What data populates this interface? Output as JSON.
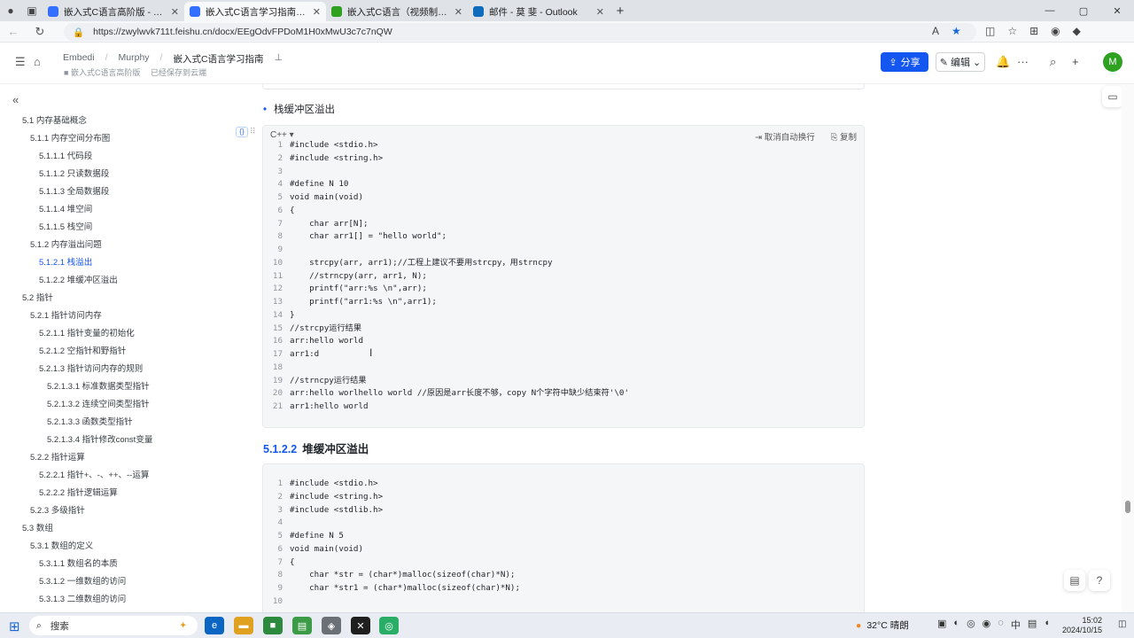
{
  "browser": {
    "tabs": [
      {
        "title": "嵌入式C语言高阶版 - 飞书云文档",
        "favicon_color": "#3370ff",
        "active": false
      },
      {
        "title": "嵌入式C语言学习指南 - 飞书云文档",
        "favicon_color": "#3370ff",
        "active": true
      },
      {
        "title": "嵌入式C语言（视频制作） - 飞书",
        "favicon_color": "#2ea121",
        "active": false
      },
      {
        "title": "邮件 - 莫 斐 - Outlook",
        "favicon_color": "#0f6cbd",
        "active": false
      }
    ],
    "url": "https://zwylwvk711t.feishu.cn/docx/EEgOdvFPDoM1H0xMwU3c7c7nQW"
  },
  "doc_header": {
    "breadcrumb": [
      "Embedi",
      "Murphy",
      "嵌入式C语言学习指南"
    ],
    "sub_left": "嵌入式C语言高阶版",
    "sub_right": "已经保存到云端",
    "share_label": "分享",
    "edit_label": "编辑",
    "avatar_letter": "M",
    "brand_color": "#1456f0"
  },
  "toc": [
    {
      "text": "5.1 内存基础概念",
      "level": 1
    },
    {
      "text": "5.1.1 内存空间分布图",
      "level": 2
    },
    {
      "text": "5.1.1.1 代码段",
      "level": 3
    },
    {
      "text": "5.1.1.2 只读数据段",
      "level": 3
    },
    {
      "text": "5.1.1.3 全局数据段",
      "level": 3
    },
    {
      "text": "5.1.1.4 堆空间",
      "level": 3
    },
    {
      "text": "5.1.1.5 栈空间",
      "level": 3
    },
    {
      "text": "5.1.2 内存溢出问题",
      "level": 2
    },
    {
      "text": "5.1.2.1 栈溢出",
      "level": 3,
      "active": true
    },
    {
      "text": "5.1.2.2 堆缓冲区溢出",
      "level": 3
    },
    {
      "text": "5.2 指针",
      "level": 1
    },
    {
      "text": "5.2.1 指针访问内存",
      "level": 2
    },
    {
      "text": "5.2.1.1 指针变量的初始化",
      "level": 3
    },
    {
      "text": "5.2.1.2 空指针和野指针",
      "level": 3
    },
    {
      "text": "5.2.1.3 指针访问内存的规则",
      "level": 3
    },
    {
      "text": "5.2.1.3.1 标准数据类型指针",
      "level": 4
    },
    {
      "text": "5.2.1.3.2 连续空间类型指针",
      "level": 4
    },
    {
      "text": "5.2.1.3.3 函数类型指针",
      "level": 4
    },
    {
      "text": "5.2.1.3.4 指针修改const变量",
      "level": 4
    },
    {
      "text": "5.2.2 指针运算",
      "level": 2
    },
    {
      "text": "5.2.2.1 指针+、-、++、--运算",
      "level": 3
    },
    {
      "text": "5.2.2.2 指针逻辑运算",
      "level": 3
    },
    {
      "text": "5.2.3 多级指针",
      "level": 2
    },
    {
      "text": "5.3 数组",
      "level": 1
    },
    {
      "text": "5.3.1 数组的定义",
      "level": 2
    },
    {
      "text": "5.3.1.1 数组名的本质",
      "level": 3
    },
    {
      "text": "5.3.1.2 一维数组的访问",
      "level": 3
    },
    {
      "text": "5.3.1.3 二维数组的访问",
      "level": 3
    }
  ],
  "content": {
    "bullet": "栈缓冲区溢出",
    "code1": {
      "lang": "C++",
      "tool_wrap": "取消自动换行",
      "tool_copy": "复制",
      "lines": [
        "#include <stdio.h>",
        "#include <string.h>",
        "",
        "#define N 10",
        "void main(void)",
        "{",
        "    char arr[N];",
        "    char arr1[] = \"hello world\";",
        "",
        "    strcpy(arr, arr1);//工程上建议不要用strcpy，用strncpy",
        "    //strncpy(arr, arr1, N);",
        "    printf(\"arr:%s \\n\",arr);",
        "    printf(\"arr1:%s \\n\",arr1);",
        "}",
        "//strcpy运行结果",
        "arr:hello world",
        "arr1:d",
        "",
        "//strncpy运行结果",
        "arr:hello worlhello world //原因是arr长度不够，copy N个字符中缺少结束符'\\0'",
        "arr1:hello world"
      ]
    },
    "section_num": "5.1.2.2",
    "section_title": "堆缓冲区溢出",
    "code2": {
      "lines": [
        "#include <stdio.h>",
        "#include <string.h>",
        "#include <stdlib.h>",
        "",
        "#define N 5",
        "void main(void)",
        "{",
        "    char *str = (char*)malloc(sizeof(char)*N);",
        "    char *str1 = (char*)malloc(sizeof(char)*N);",
        ""
      ]
    }
  },
  "taskbar": {
    "search": "搜索",
    "weather": "32°C  晴朗",
    "ime": "中",
    "time": "15:02",
    "date": "2024/10/15"
  }
}
